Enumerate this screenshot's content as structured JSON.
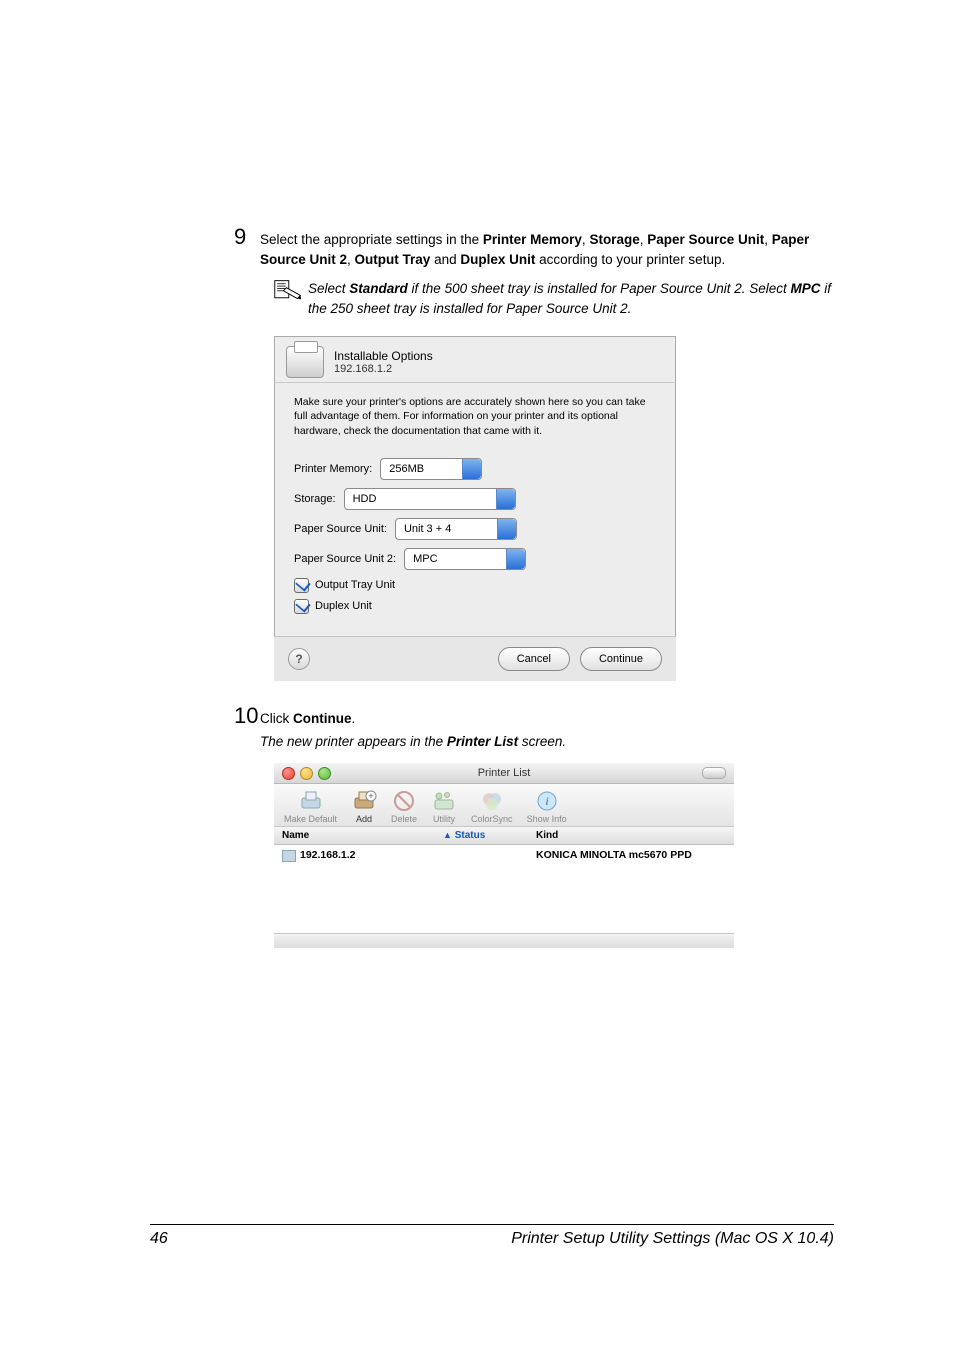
{
  "step9": {
    "num": "9",
    "text_before": "Select the appropriate settings in the ",
    "b1": "Printer Memory",
    "c1": ", ",
    "b2": "Storage",
    "c2": ", ",
    "b3": "Paper Source Unit",
    "c3": ", ",
    "b4": "Paper Source Unit 2",
    "c4": ", ",
    "b5": "Output Tray",
    "c5": " and ",
    "b6": "Duplex Unit",
    "text_after": " according to your printer setup."
  },
  "note": {
    "p1a": "Select ",
    "p1b": "Standard",
    "p1c": " if the 500 sheet tray is installed for Paper Source Unit 2. Select ",
    "p1d": "MPC",
    "p1e": " if the 250 sheet tray is installed for Paper Source Unit 2."
  },
  "dlg1": {
    "title": "Installable Options",
    "ip": "192.168.1.2",
    "info": "Make sure your printer's options are accurately shown here so you can take full advantage of them. For information on your printer and its optional hardware, check the documentation that came with it.",
    "mem_label": "Printer Memory:",
    "mem_val": "256MB",
    "stor_label": "Storage:",
    "stor_val": "HDD",
    "psu_label": "Paper Source Unit:",
    "psu_val": "Unit 3 + 4",
    "psu2_label": "Paper Source Unit 2:",
    "psu2_val": "MPC",
    "chk1": "Output Tray Unit",
    "chk2": "Duplex Unit",
    "help": "?",
    "cancel": "Cancel",
    "continue": "Continue"
  },
  "step10": {
    "num": "10",
    "text_a": "Click ",
    "text_b": "Continue",
    "text_c": ".",
    "result_a": "The new printer appears in the ",
    "result_b": "Printer List",
    "result_c": " screen."
  },
  "dlg2": {
    "title": "Printer List",
    "tb": {
      "make": "Make Default",
      "add": "Add",
      "del": "Delete",
      "util": "Utility",
      "cs": "ColorSync",
      "info": "Show Info"
    },
    "cols": {
      "name": "Name",
      "status": "Status",
      "kind": "Kind"
    },
    "row": {
      "name": "192.168.1.2",
      "status": "",
      "kind": "KONICA MINOLTA mc5670 PPD"
    }
  },
  "footer": {
    "page": "46",
    "title": "Printer Setup Utility Settings (Mac OS X 10.4)"
  }
}
